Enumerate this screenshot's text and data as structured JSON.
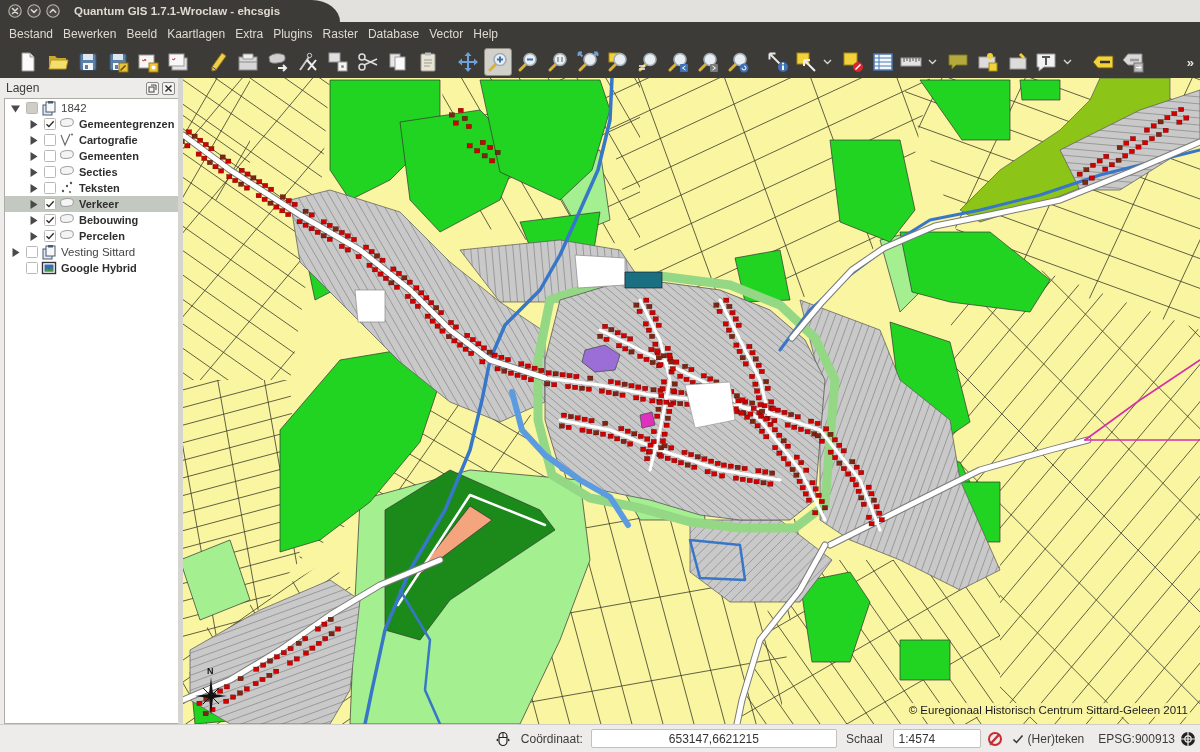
{
  "window": {
    "title": "Quantum GIS 1.7.1-Wroclaw - ehcsgis"
  },
  "menu": [
    "Bestand",
    "Bewerken",
    "Beeld",
    "Kaartlagen",
    "Extra",
    "Plugins",
    "Raster",
    "Database",
    "Vector",
    "Help"
  ],
  "toolbar": {
    "groups": [
      [
        {
          "kind": "new",
          "selected": false,
          "dropdown": false
        },
        {
          "kind": "open",
          "selected": false,
          "dropdown": false
        },
        {
          "kind": "save",
          "selected": false,
          "dropdown": false
        },
        {
          "kind": "saveas",
          "selected": false,
          "dropdown": false
        },
        {
          "kind": "composer",
          "selected": false,
          "dropdown": false
        },
        {
          "kind": "composers",
          "selected": false,
          "dropdown": false
        }
      ],
      [
        {
          "kind": "pencil",
          "selected": false,
          "dropdown": false
        },
        {
          "kind": "savelayer",
          "selected": false,
          "dropdown": false
        },
        {
          "kind": "addfeature",
          "selected": false,
          "dropdown": false
        },
        {
          "kind": "nodetool",
          "selected": false,
          "dropdown": false
        },
        {
          "kind": "movefeature",
          "selected": false,
          "dropdown": false
        },
        {
          "kind": "cut",
          "selected": false,
          "dropdown": false
        },
        {
          "kind": "copy",
          "selected": false,
          "dropdown": false
        },
        {
          "kind": "paste",
          "selected": false,
          "dropdown": false
        }
      ],
      [
        {
          "kind": "pan",
          "selected": false,
          "dropdown": false
        },
        {
          "kind": "zoomin",
          "selected": true,
          "dropdown": false
        },
        {
          "kind": "zoomout",
          "selected": false,
          "dropdown": false
        },
        {
          "kind": "zoomactual",
          "selected": false,
          "dropdown": false
        },
        {
          "kind": "zoomfull",
          "selected": false,
          "dropdown": false
        },
        {
          "kind": "zoomselect",
          "selected": false,
          "dropdown": false
        },
        {
          "kind": "zoomlayer",
          "selected": false,
          "dropdown": false
        },
        {
          "kind": "zoomlast",
          "selected": false,
          "dropdown": false
        },
        {
          "kind": "zoomnext",
          "selected": false,
          "dropdown": false
        },
        {
          "kind": "refresh",
          "selected": false,
          "dropdown": false
        }
      ],
      [
        {
          "kind": "identify",
          "selected": false,
          "dropdown": false
        },
        {
          "kind": "select",
          "selected": false,
          "dropdown": true
        },
        {
          "kind": "deselect",
          "selected": false,
          "dropdown": false
        },
        {
          "kind": "table",
          "selected": false,
          "dropdown": false
        },
        {
          "kind": "measure",
          "selected": false,
          "dropdown": true
        },
        {
          "kind": "annotation",
          "selected": false,
          "dropdown": false
        },
        {
          "kind": "label",
          "selected": false,
          "dropdown": false
        },
        {
          "kind": "labeltag",
          "selected": false,
          "dropdown": false
        },
        {
          "kind": "textannotation",
          "selected": false,
          "dropdown": true
        }
      ],
      [
        {
          "kind": "abclabel",
          "selected": false,
          "dropdown": false
        },
        {
          "kind": "abcmove",
          "selected": false,
          "dropdown": false
        }
      ]
    ],
    "overflow": "»"
  },
  "layers_panel": {
    "title": "Lagen",
    "layers": [
      {
        "name": "1842",
        "kind": "group",
        "checked": false,
        "partial": true,
        "expanded": true,
        "selected": false,
        "children": [
          {
            "name": "Gemeentegrenzen",
            "kind": "polygon",
            "checked": true,
            "partial": false,
            "expanded": false,
            "selected": false
          },
          {
            "name": "Cartografie",
            "kind": "line",
            "checked": false,
            "partial": false,
            "expanded": false,
            "selected": false
          },
          {
            "name": "Gemeenten",
            "kind": "polygon",
            "checked": false,
            "partial": false,
            "expanded": false,
            "selected": false
          },
          {
            "name": "Secties",
            "kind": "polygon",
            "checked": false,
            "partial": false,
            "expanded": false,
            "selected": false
          },
          {
            "name": "Teksten",
            "kind": "point",
            "checked": false,
            "partial": false,
            "expanded": false,
            "selected": false
          },
          {
            "name": "Verkeer",
            "kind": "polygon",
            "checked": true,
            "partial": false,
            "expanded": false,
            "selected": true
          },
          {
            "name": "Bebouwing",
            "kind": "polygon",
            "checked": true,
            "partial": false,
            "expanded": false,
            "selected": false
          },
          {
            "name": "Percelen",
            "kind": "polygon",
            "checked": true,
            "partial": false,
            "expanded": false,
            "selected": false
          }
        ]
      },
      {
        "name": "Vesting Sittard",
        "kind": "group",
        "checked": false,
        "partial": false,
        "expanded": false,
        "selected": false
      },
      {
        "name": "Google Hybrid",
        "kind": "raster",
        "checked": false,
        "partial": false,
        "selected": false
      }
    ]
  },
  "map": {
    "north_label": "N",
    "attribution": "© Euregionaal Historisch Centrum Sittard-Geleen 2011"
  },
  "status_bar": {
    "coordinate_label": "Coördinaat:",
    "coordinate": "653147,6621215",
    "scale_label": "Schaal",
    "scale": "1:4574",
    "render": {
      "label": "(Her)teken",
      "checked": true
    },
    "crs": "EPSG:900913"
  }
}
